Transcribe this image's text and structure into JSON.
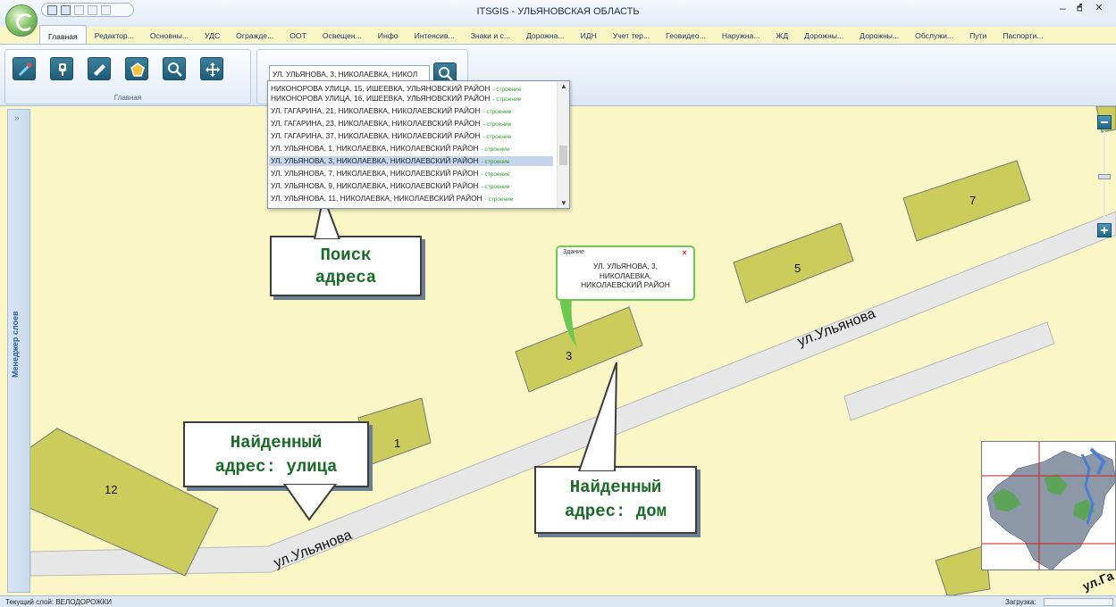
{
  "window": {
    "title": "ITSGIS - УЛЬЯНОВСКАЯ ОБЛАСТЬ",
    "minimize": "–",
    "restore": "🗗",
    "close": "✕"
  },
  "ribbon_tabs": [
    "Главная",
    "Редактор...",
    "Основны...",
    "УДС",
    "Огражде...",
    "ООТ",
    "Освещен...",
    "Инфо",
    "Интенсив...",
    "Знаки и с...",
    "Дорожна...",
    "ИДН",
    "Учет тер...",
    "Геовидео...",
    "Наружна...",
    "ЖД",
    "Дорожны...",
    "Дорожны...",
    "Обслужи...",
    "Пути",
    "Паспорти..."
  ],
  "ribbon": {
    "group_label": "Главная",
    "tools": [
      "select-tool-icon",
      "place-marker-icon",
      "ruler-icon",
      "polygon-icon",
      "zoom-icon",
      "pan-icon"
    ]
  },
  "search": {
    "value": "УЛ. УЛЬЯНОВА, 3, НИКОЛАЕВКА, НИКОЛ"
  },
  "search_results": [
    {
      "address": "НИКОНОРОВА УЛИЦА, 15, ИШЕЕВКА, УЛЬЯНОВСКИЙ РАЙОН",
      "type": "- строение"
    },
    {
      "address": "НИКОНОРОВА УЛИЦА, 16, ИШЕЕВКА, УЛЬЯНОВСКИЙ РАЙОН",
      "type": "- строение"
    },
    {
      "address": "УЛ. ГАГАРИНА, 21, НИКОЛАЕВКА, НИКОЛАЕВСКИЙ РАЙОН",
      "type": "- строение"
    },
    {
      "address": "УЛ. ГАГАРИНА, 23, НИКОЛАЕВКА, НИКОЛАЕВСКИЙ РАЙОН",
      "type": "- строение"
    },
    {
      "address": "УЛ. ГАГАРИНА, 37, НИКОЛАЕВКА, НИКОЛАЕВСКИЙ РАЙОН",
      "type": "- строение"
    },
    {
      "address": "УЛ. УЛЬЯНОВА, 1, НИКОЛАЕВКА, НИКОЛАЕВСКИЙ РАЙОН",
      "type": "- строение"
    },
    {
      "address": "УЛ. УЛЬЯНОВА, 3, НИКОЛАЕВКА, НИКОЛАЕВСКИЙ РАЙОН",
      "type": "- строение"
    },
    {
      "address": "УЛ. УЛЬЯНОВА, 7, НИКОЛАЕВКА, НИКОЛАЕВСКИЙ РАЙОН",
      "type": "- строение"
    },
    {
      "address": "УЛ. УЛЬЯНОВА, 9, НИКОЛАЕВКА, НИКОЛАЕВСКИЙ РАЙОН",
      "type": "- строение"
    },
    {
      "address": "УЛ. УЛЬЯНОВА, 11, НИКОЛАЕВКА, НИКОЛАЕВСКИЙ РАЙОН",
      "type": "- строение"
    }
  ],
  "selected_result_index": 6,
  "layer_manager": {
    "label": "Менеджер слоев",
    "expand_glyph": "»"
  },
  "map": {
    "street_name": "ул.Ульянова",
    "buildings": [
      "1",
      "3",
      "5",
      "7",
      "12"
    ],
    "corner_label": "ул.Га"
  },
  "popup": {
    "header": "Здание",
    "close": "×",
    "line1": "УЛ. УЛЬЯНОВА, 3,",
    "line2": "НИКОЛАЕВКА,",
    "line3": "НИКОЛАЕВСКИЙ РАЙОН"
  },
  "callouts": {
    "search_line1": "Поиск",
    "search_line2": "адреса",
    "street_line1": "Найденный",
    "street_line2": "адрес: улица",
    "house_line1": "Найденный",
    "house_line2": "адрес: дом"
  },
  "statusbar": {
    "current_layer": "Текущий слой: ВЕЛОДОРОЖКИ",
    "load_label": "Загрузка:"
  },
  "colors": {
    "map_background": "#fbf6c6",
    "building_fill": "#cbcc5c",
    "road_fill": "#e7e7e7",
    "callout_text": "#1b6b2a",
    "popup_border": "#6cc94f"
  }
}
